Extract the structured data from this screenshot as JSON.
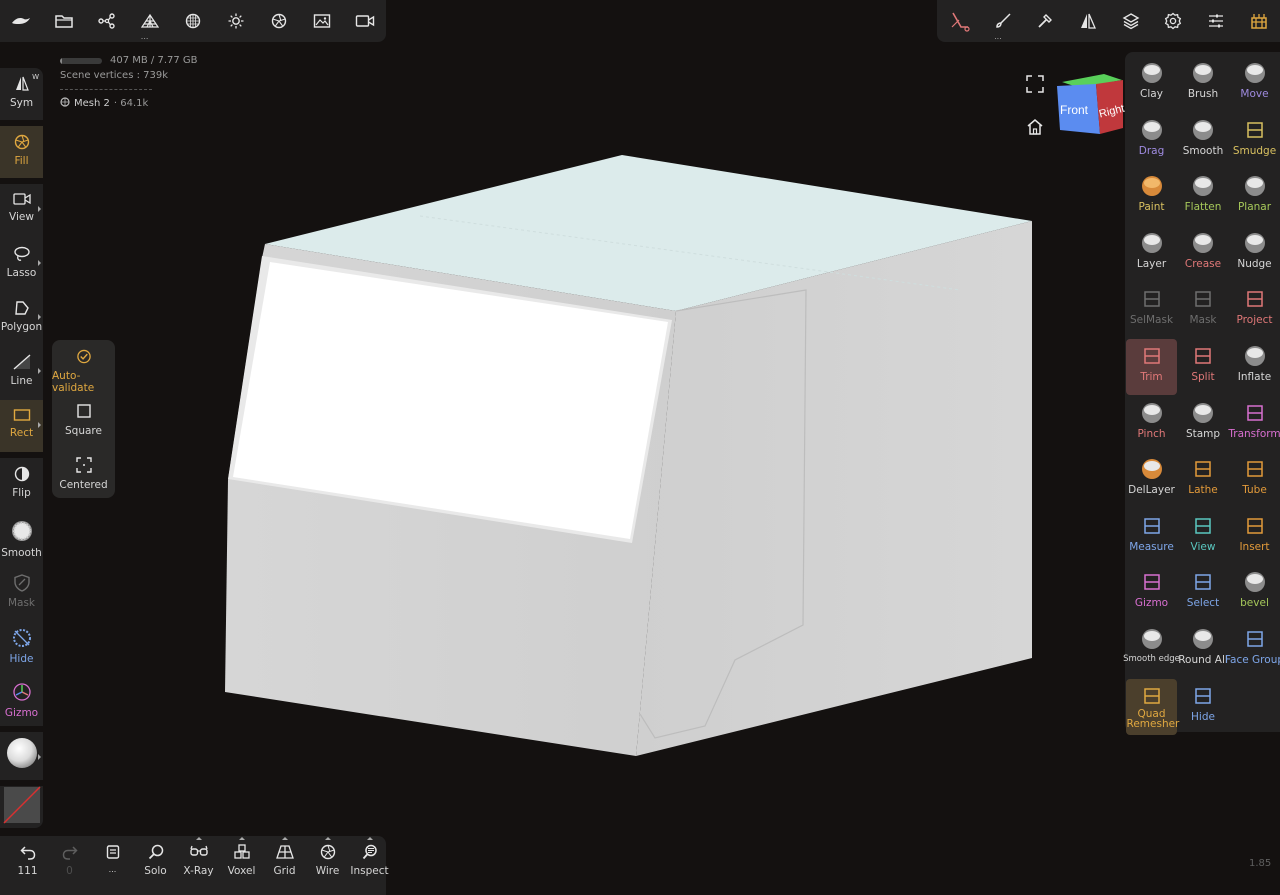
{
  "colors": {
    "background": "#141110",
    "panel": "#232222",
    "accent_gold": "#e0a840",
    "trim_active": "#5a3c3c",
    "cube_top": "#dbeaea",
    "cube_front": "#d2d2d2",
    "cube_side": "#c8c8c8",
    "nav_cube_front": "#5b8cf0",
    "nav_cube_right": "#c0383c",
    "nav_cube_top": "#59d05a"
  },
  "top_left_toolbar": {
    "icons": [
      "nomad-logo-icon",
      "folder-icon",
      "scene-graph-icon",
      "topology-icon",
      "material-sphere-icon",
      "light-sun-icon",
      "camera-shutter-icon",
      "image-icon",
      "video-camera-icon"
    ]
  },
  "top_right_toolbar": {
    "icons": [
      "trim-tool-icon",
      "paint-brush-icon",
      "hammer-icon",
      "symmetry-icon",
      "layers-icon",
      "settings-gear-icon",
      "sliders-icon",
      "interface-icon"
    ]
  },
  "info": {
    "memory": "407 MB / 7.77 GB",
    "memory_fraction": 0.05,
    "vertices": "Scene vertices : 739k",
    "mesh_name": "Mesh 2",
    "mesh_vertices": "· 64.1k"
  },
  "left_toolbar": {
    "sym": {
      "label": "Sym",
      "badge": "W"
    },
    "fill": {
      "label": "Fill"
    },
    "view": {
      "label": "View"
    },
    "lasso": {
      "label": "Lasso"
    },
    "polygon": {
      "label": "Polygon"
    },
    "line": {
      "label": "Line"
    },
    "rect": {
      "label": "Rect"
    },
    "flip": {
      "label": "Flip"
    },
    "smooth": {
      "label": "Smooth"
    },
    "mask": {
      "label": "Mask"
    },
    "hide": {
      "label": "Hide"
    },
    "gizmo": {
      "label": "Gizmo"
    }
  },
  "rect_popup": {
    "auto_validate": "Auto-validate",
    "square": "Square",
    "centered": "Centered"
  },
  "nav_cube": {
    "front": "Front",
    "right": "Right"
  },
  "tools": [
    {
      "label": "Clay",
      "color": "white"
    },
    {
      "label": "Brush",
      "color": "white"
    },
    {
      "label": "Move",
      "color": "violet"
    },
    {
      "label": "Drag",
      "color": "violet"
    },
    {
      "label": "Smooth",
      "color": "white"
    },
    {
      "label": "Smudge",
      "color": "yellow"
    },
    {
      "label": "Paint",
      "color": "yellow"
    },
    {
      "label": "Flatten",
      "color": "lime"
    },
    {
      "label": "Planar",
      "color": "lime"
    },
    {
      "label": "Layer",
      "color": "white"
    },
    {
      "label": "Crease",
      "color": "pink"
    },
    {
      "label": "Nudge",
      "color": "white"
    },
    {
      "label": "SelMask",
      "color": "grey"
    },
    {
      "label": "Mask",
      "color": "grey"
    },
    {
      "label": "Project",
      "color": "pink"
    },
    {
      "label": "Trim",
      "color": "pink"
    },
    {
      "label": "Split",
      "color": "pink"
    },
    {
      "label": "Inflate",
      "color": "white"
    },
    {
      "label": "Pinch",
      "color": "pink"
    },
    {
      "label": "Stamp",
      "color": "white"
    },
    {
      "label": "Transform",
      "color": "magenta"
    },
    {
      "label": "DelLayer",
      "color": "white"
    },
    {
      "label": "Lathe",
      "color": "orange"
    },
    {
      "label": "Tube",
      "color": "orange"
    },
    {
      "label": "Measure",
      "color": "blue"
    },
    {
      "label": "View",
      "color": "cyan"
    },
    {
      "label": "Insert",
      "color": "orange"
    },
    {
      "label": "Gizmo",
      "color": "magenta"
    },
    {
      "label": "Select",
      "color": "blue"
    },
    {
      "label": "bevel",
      "color": "lime"
    },
    {
      "label": "Smooth edge",
      "color": "white"
    },
    {
      "label": "Round All",
      "color": "white"
    },
    {
      "label": "Face Group",
      "color": "blue"
    },
    {
      "label": "Quad Remesher",
      "color": "gold"
    },
    {
      "label": "Hide",
      "color": "blue"
    }
  ],
  "bottom_toolbar": {
    "undo": {
      "label": "111"
    },
    "redo": {
      "label": "0"
    },
    "more": {
      "label": "..."
    },
    "solo": {
      "label": "Solo"
    },
    "xray": {
      "label": "X-Ray"
    },
    "voxel": {
      "label": "Voxel"
    },
    "grid": {
      "label": "Grid"
    },
    "wire": {
      "label": "Wire"
    },
    "inspect": {
      "label": "Inspect"
    }
  },
  "version": "1.85"
}
